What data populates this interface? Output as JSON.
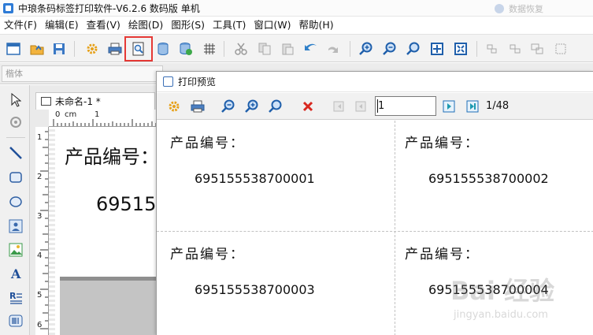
{
  "app": {
    "title": "中琅条码标签打印软件-V6.2.6 数码版 单机"
  },
  "background_windows": {
    "item_1": "",
    "item_2": "数据恢复"
  },
  "menubar": {
    "items": [
      "文件(F)",
      "编辑(E)",
      "查看(V)",
      "绘图(D)",
      "图形(S)",
      "工具(T)",
      "窗口(W)",
      "帮助(H)"
    ]
  },
  "toolbar": {
    "buttons": [
      "new-icon",
      "open-icon",
      "save-icon",
      "settings-icon",
      "print-icon",
      "print-preview-icon",
      "database-icon",
      "database-settings-icon",
      "grid-icon",
      "cut-icon",
      "copy-icon",
      "paste-icon",
      "undo-icon",
      "redo-icon",
      "zoom-in-icon",
      "zoom-out-icon",
      "zoom-fit-icon",
      "zoom-page-icon",
      "zoom-all-icon",
      "align-left-icon",
      "align-center-icon",
      "align-right-icon",
      "group-icon"
    ],
    "highlighted": "print-preview-icon",
    "highlight_color": "#e53935"
  },
  "font_bar": {
    "placeholder": "楷体"
  },
  "left_tools": [
    "select-arrow-icon",
    "rotate-icon",
    "line-icon",
    "rectangle-icon",
    "ellipse-icon",
    "image-icon",
    "picture-icon",
    "text-icon",
    "multiline-text-icon",
    "barcode-icon"
  ],
  "document": {
    "tab_label": "未命名-1 *",
    "ruler_h_labels": [
      "0",
      "cm",
      "1"
    ],
    "ruler_v_labels": [
      "1",
      "2",
      "3",
      "4",
      "5",
      "6"
    ],
    "canvas_label": "产品编号：",
    "canvas_value": "69515"
  },
  "preview": {
    "title": "打印预览",
    "current_page": "1",
    "page_count": "1/48",
    "cells": [
      {
        "label": "产品编号：",
        "value": "695155538700001"
      },
      {
        "label": "产品编号：",
        "value": "695155538700002"
      },
      {
        "label": "产品编号：",
        "value": "695155538700003"
      },
      {
        "label": "产品编号：",
        "value": "695155538700004"
      }
    ]
  },
  "watermark": {
    "logo": "Bai 经验",
    "url": "jingyan.baidu.com"
  },
  "colors": {
    "accent_blue": "#2e7bd6",
    "highlight_red": "#e53935"
  }
}
